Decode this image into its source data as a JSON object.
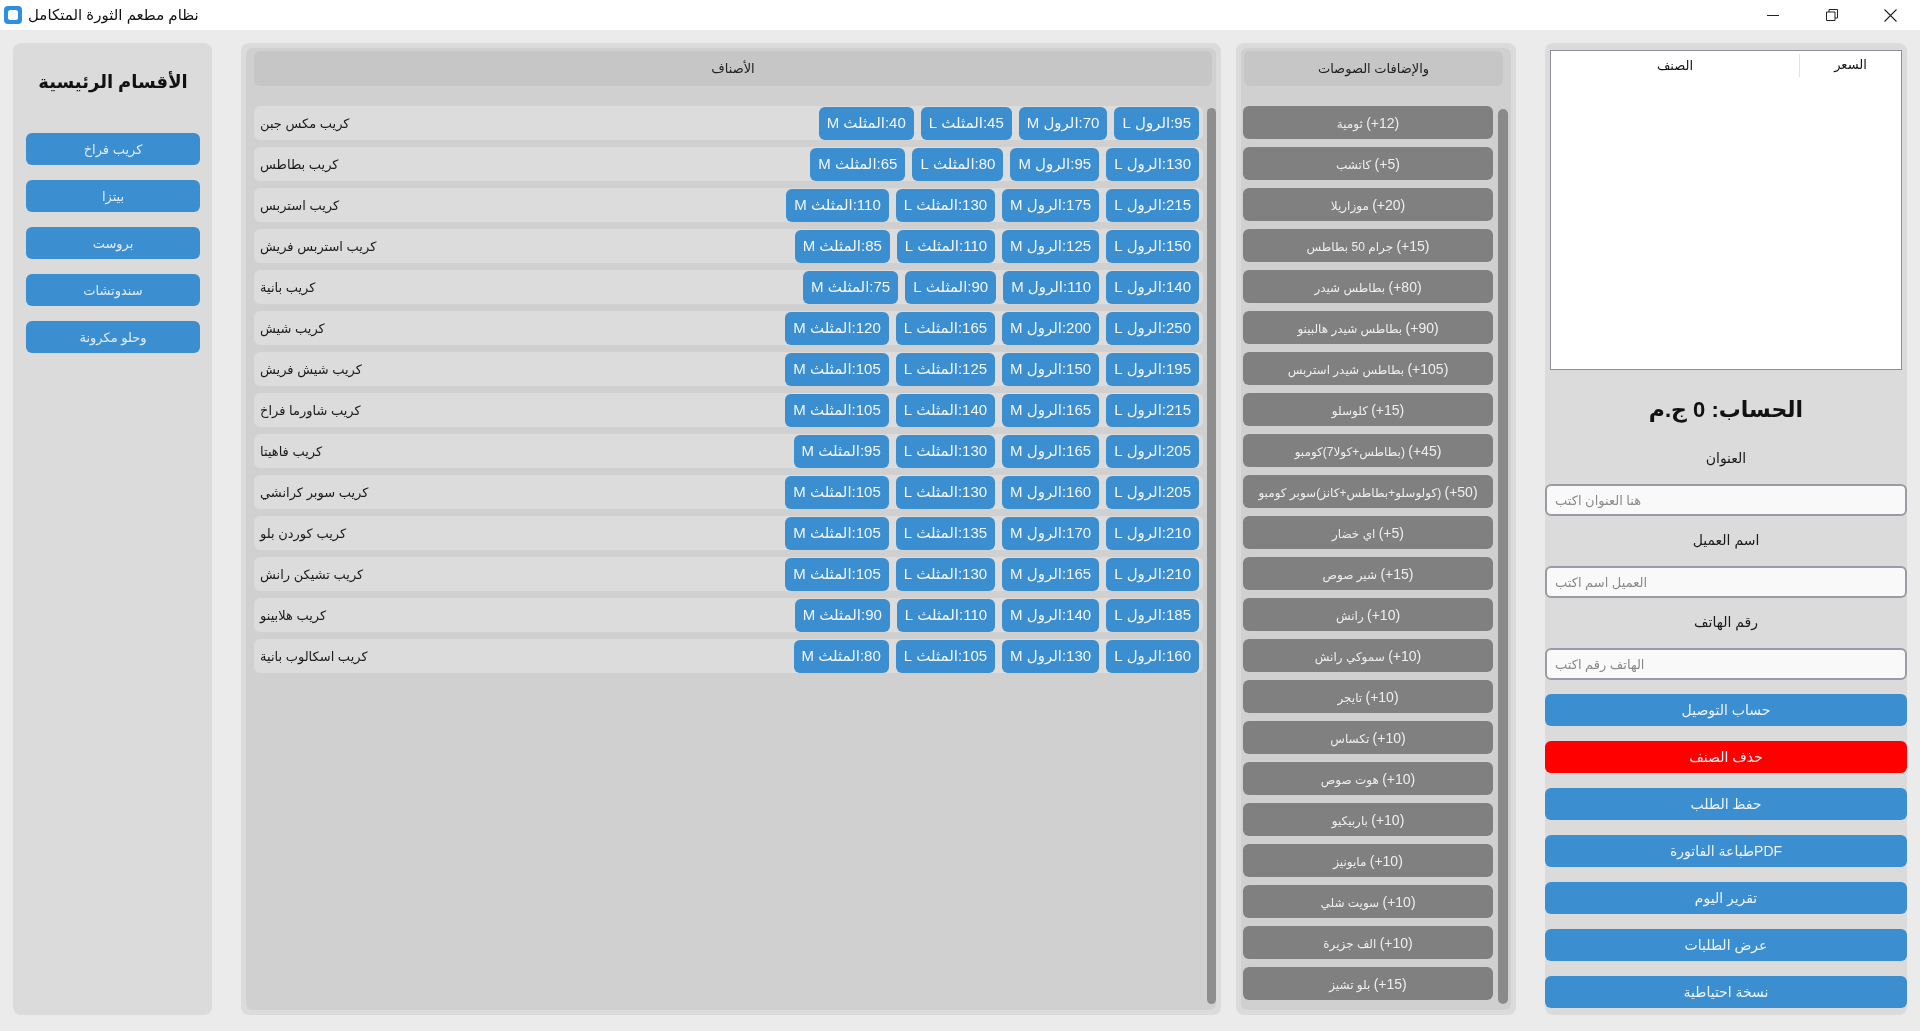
{
  "window": {
    "title": "نظام مطعم الثورة المتكامل"
  },
  "categories": {
    "title": "الأقسام الرئيسية",
    "items": [
      "كريب فراخ",
      "بيتزا",
      "بروست",
      "سندوتشات",
      "وحلو مكرونة"
    ]
  },
  "menu": {
    "header": "الأصناف",
    "rows": [
      {
        "name": "كريب مكس جبن",
        "prices": [
          "95:الرول L",
          "70:الرول M",
          "45:المثلث L",
          "40:المثلث M"
        ]
      },
      {
        "name": "كريب بطاطس",
        "prices": [
          "130:الرول L",
          "95:الرول M",
          "80:المثلث L",
          "65:المثلث M"
        ]
      },
      {
        "name": "كريب استربس",
        "prices": [
          "215:الرول L",
          "175:الرول M",
          "130:المثلث L",
          "110:المثلث M"
        ]
      },
      {
        "name": "كريب استربس فريش",
        "prices": [
          "150:الرول L",
          "125:الرول M",
          "110:المثلث L",
          "85:المثلث M"
        ]
      },
      {
        "name": "كريب بانية",
        "prices": [
          "140:الرول L",
          "110:الرول M",
          "90:المثلث L",
          "75:المثلث M"
        ]
      },
      {
        "name": "كريب شيش",
        "prices": [
          "250:الرول L",
          "200:الرول M",
          "165:المثلث L",
          "120:المثلث M"
        ]
      },
      {
        "name": "كريب شيش فريش",
        "prices": [
          "195:الرول L",
          "150:الرول M",
          "125:المثلث L",
          "105:المثلث M"
        ]
      },
      {
        "name": "كريب شاورما فراخ",
        "prices": [
          "215:الرول L",
          "165:الرول M",
          "140:المثلث L",
          "105:المثلث M"
        ]
      },
      {
        "name": "كريب فاهيتا",
        "prices": [
          "205:الرول L",
          "165:الرول M",
          "130:المثلث L",
          "95:المثلث M"
        ]
      },
      {
        "name": "كريب سوبر كرانشي",
        "prices": [
          "205:الرول L",
          "160:الرول M",
          "130:المثلث L",
          "105:المثلث M"
        ]
      },
      {
        "name": "كريب كوردن بلو",
        "prices": [
          "210:الرول L",
          "170:الرول M",
          "135:المثلث L",
          "105:المثلث M"
        ]
      },
      {
        "name": "كريب تشيكن رانش",
        "prices": [
          "210:الرول L",
          "165:الرول M",
          "130:المثلث L",
          "105:المثلث M"
        ]
      },
      {
        "name": "كريب هلابينو",
        "prices": [
          "185:الرول L",
          "140:الرول M",
          "110:المثلث L",
          "90:المثلث M"
        ]
      },
      {
        "name": "كريب اسكالوب بانية",
        "prices": [
          "160:الرول L",
          "130:الرول M",
          "105:المثلث L",
          "80:المثلث M"
        ]
      }
    ]
  },
  "addons": {
    "header": "والإضافات الصوصات",
    "items": [
      "(+12) ثومية",
      "(+5) كاتشب",
      "(+20) موزاريلا",
      "(+15) جرام 50 بطاطس",
      "(+80) بطاطس شيدر",
      "(+90) بطاطس شيدر هالبينو",
      "(+105) بطاطس شيدر استربس",
      "(+15) كلوسلو",
      "(+45) (بطاطس+كولا7)كومبو",
      "(+50) (كولوسلو+بطاطس+كانز)سوبر كومبو",
      "(+5) اي خضار",
      "(+15) شير صوص",
      "(+10) رانش",
      "(+10) سموكي رانش",
      "(+10) تايجر",
      "(+10) تكساس",
      "(+10) هوت صوص",
      "(+10) باربيكيو",
      "(+10) مايونيز",
      "(+10) سويت شلي",
      "(+10) الف جزيرة",
      "(+15) بلو تشيز"
    ]
  },
  "order": {
    "columns": [
      "السعر",
      "الصنف"
    ],
    "total": "الحساب: 0 ج.م",
    "fields": [
      {
        "label": "العنوان",
        "placeholder": "هنا العنوان اكتب"
      },
      {
        "label": "اسم العميل",
        "placeholder": "العميل اسم اكتب"
      },
      {
        "label": "رقم الهاتف",
        "placeholder": "الهاتف رقم اكتب"
      }
    ],
    "buttons": [
      {
        "label": "حساب التوصيل",
        "kind": "primary"
      },
      {
        "label": "حذف الصنف",
        "kind": "danger"
      },
      {
        "label": "حفظ الطلب",
        "kind": "primary"
      },
      {
        "label": "PDFطباعة الفاتورة",
        "kind": "primary"
      },
      {
        "label": "تقرير اليوم",
        "kind": "primary"
      },
      {
        "label": "عرض الطلبات",
        "kind": "primary"
      },
      {
        "label": "نسخة احتياطية",
        "kind": "primary"
      }
    ]
  }
}
